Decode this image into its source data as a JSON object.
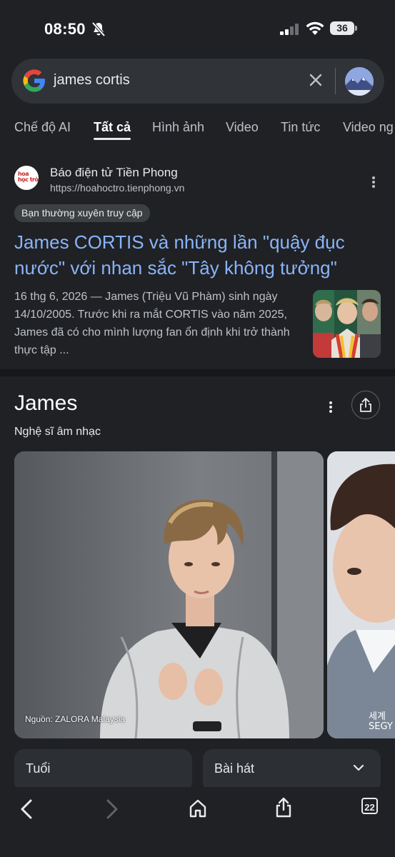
{
  "status_bar": {
    "time": "08:50",
    "battery": "36"
  },
  "search": {
    "query": "james cortis"
  },
  "tabs": [
    "Chế độ AI",
    "Tất cả",
    "Hình ảnh",
    "Video",
    "Tin tức",
    "Video ng"
  ],
  "active_tab": "Tất cả",
  "result": {
    "site_logo_text": "hoa học trò",
    "site_name": "Báo điện tử Tiền Phong",
    "site_url": "https://hoahoctro.tienphong.vn",
    "badge": "Bạn thường xuyên truy cập",
    "title": "James CORTIS và những lần \"quậy đục nước\" với nhan sắc \"Tây không tưởng\"",
    "snippet": "16 thg 6, 2026 — James (Triệu Vũ Phàm) sinh ngày 14/10/2005. Trước khi ra mắt CORTIS vào năm 2025, James đã có cho mình lượng fan ổn định khi trở thành thực tập ..."
  },
  "knowledge_panel": {
    "title": "James",
    "subtitle": "Nghệ sĩ âm nhạc",
    "photo_source": "Nguồn: ZALORA Malaysia",
    "second_photo_caption": "세계\nSEGY",
    "chips": [
      "Tuổi",
      "Bài hát"
    ]
  },
  "bottom_nav": {
    "tabs_count": "22"
  }
}
